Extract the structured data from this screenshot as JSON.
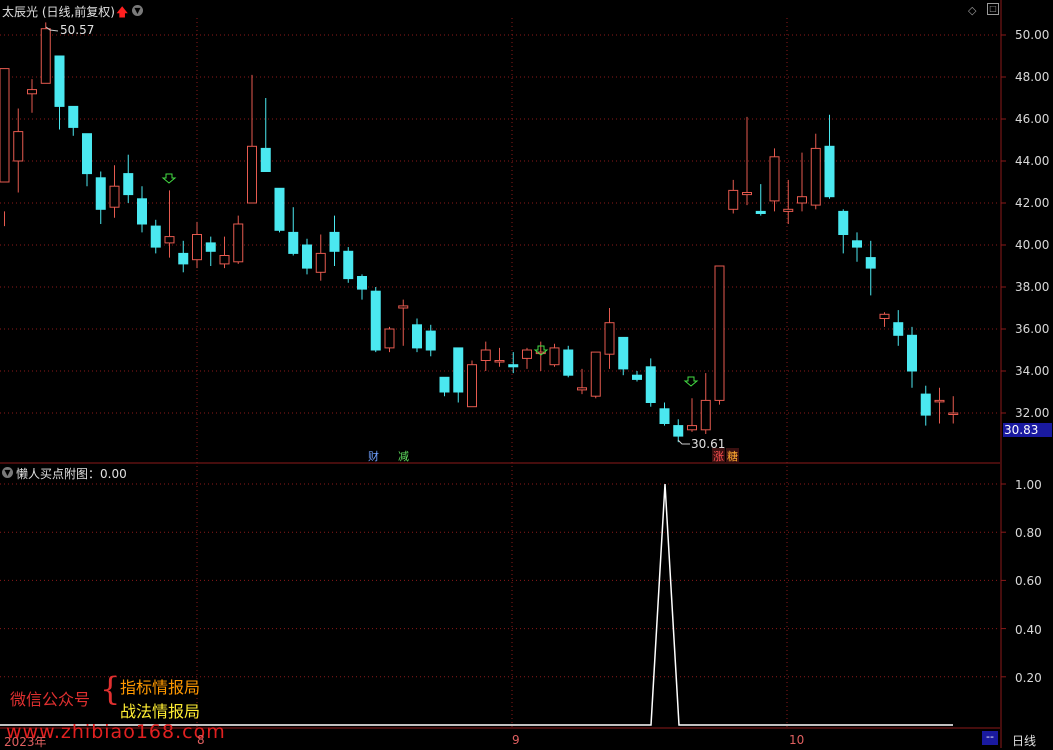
{
  "header": {
    "title": "太辰光 (日线,前复权)"
  },
  "indicator": {
    "title": "懒人买点附图：0.00"
  },
  "price_axis": {
    "labels": [
      "50.00",
      "48.00",
      "46.00",
      "44.00",
      "42.00",
      "40.00",
      "38.00",
      "36.00",
      "34.00",
      "32.00"
    ],
    "last_price": "30.83"
  },
  "ind_axis": {
    "labels": [
      "1.00",
      "0.80",
      "0.60",
      "0.40",
      "0.20"
    ]
  },
  "x_axis": {
    "labels": [
      "2023年",
      "8",
      "9",
      "10"
    ],
    "period": "日线",
    "period_btn": "--"
  },
  "annotations": {
    "high": "50.57",
    "low": "30.61"
  },
  "events": [
    {
      "label": "财",
      "color": "#6fa0ff"
    },
    {
      "label": "减",
      "color": "#60e060"
    },
    {
      "label": "涨",
      "color": "#ff5050"
    },
    {
      "label": "糖",
      "color": "#ffaa30"
    }
  ],
  "watermark": {
    "left": "微信公众号",
    "right1": "指标情报局",
    "right2": "战法情报局",
    "site": "www.zhibiao168.com"
  },
  "colors": {
    "up": "#e65a4f",
    "down": "#4be8f0",
    "grid": "#8b1a1a"
  },
  "chart_data": {
    "type": "candlestick",
    "ylim": [
      30,
      51
    ],
    "candles": [
      [
        43,
        48.4,
        40.9,
        41.6
      ],
      [
        44,
        45.4,
        42.5,
        46.5
      ],
      [
        47.2,
        47.4,
        46.3,
        47.9
      ],
      [
        47.7,
        50.3,
        47.7,
        50.6
      ],
      [
        49.0,
        46.6,
        45.5,
        49.0
      ],
      [
        46.6,
        45.6,
        45.2,
        46.6
      ],
      [
        45.3,
        43.4,
        42.8,
        45.3
      ],
      [
        43.2,
        41.7,
        41.0,
        43.5
      ],
      [
        41.8,
        42.8,
        41.3,
        43.8
      ],
      [
        43.4,
        42.4,
        42.0,
        44.3
      ],
      [
        42.2,
        41.0,
        40.6,
        42.8
      ],
      [
        40.9,
        39.9,
        39.6,
        41.2
      ],
      [
        40.1,
        40.4,
        39.4,
        42.6
      ],
      [
        39.6,
        39.1,
        38.7,
        40.2
      ],
      [
        39.3,
        40.5,
        38.9,
        41.1
      ],
      [
        40.1,
        39.7,
        39.0,
        40.4
      ],
      [
        39.1,
        39.5,
        38.9,
        40.4
      ],
      [
        39.2,
        41.0,
        39.1,
        41.4
      ],
      [
        42.0,
        44.7,
        42.0,
        48.1
      ],
      [
        44.6,
        43.5,
        43.5,
        47.0
      ],
      [
        42.7,
        40.7,
        40.6,
        42.7
      ],
      [
        40.6,
        39.6,
        39.5,
        41.8
      ],
      [
        40.0,
        38.9,
        38.6,
        40.3
      ],
      [
        38.7,
        39.6,
        38.3,
        40.5
      ],
      [
        40.6,
        39.7,
        39.0,
        41.4
      ],
      [
        39.7,
        38.4,
        38.2,
        39.9
      ],
      [
        38.5,
        37.9,
        37.4,
        38.6
      ],
      [
        37.8,
        35.0,
        34.9,
        38.0
      ],
      [
        35.1,
        36.0,
        34.9,
        36.1
      ],
      [
        37.0,
        37.1,
        35.2,
        37.4
      ],
      [
        36.2,
        35.1,
        34.9,
        36.5
      ],
      [
        35.9,
        35.0,
        34.7,
        36.2
      ],
      [
        33.7,
        33.0,
        32.8,
        33.7
      ],
      [
        35.1,
        33.0,
        32.5,
        35.1
      ],
      [
        32.3,
        34.3,
        32.3,
        34.5
      ],
      [
        34.5,
        35.0,
        34.0,
        35.4
      ],
      [
        34.5,
        34.5,
        34.2,
        35.1
      ],
      [
        34.3,
        34.2,
        33.9,
        34.9
      ],
      [
        34.6,
        35.0,
        34.1,
        35.1
      ],
      [
        34.9,
        34.9,
        34.0,
        35.4
      ],
      [
        34.3,
        35.1,
        34.2,
        35.3
      ],
      [
        35.0,
        33.8,
        33.7,
        35.2
      ],
      [
        33.1,
        33.2,
        32.9,
        34.1
      ],
      [
        32.8,
        34.9,
        32.7,
        34.9
      ],
      [
        34.8,
        36.3,
        34.1,
        37.0
      ],
      [
        35.6,
        34.1,
        33.8,
        35.6
      ],
      [
        33.8,
        33.6,
        33.5,
        34.0
      ],
      [
        34.2,
        32.5,
        32.3,
        34.6
      ],
      [
        32.2,
        31.5,
        31.4,
        32.5
      ],
      [
        31.4,
        30.9,
        30.61,
        31.7
      ],
      [
        31.2,
        31.4,
        31.1,
        32.7
      ],
      [
        31.2,
        32.6,
        31.0,
        33.9
      ],
      [
        32.6,
        39.0,
        32.4,
        39.0
      ],
      [
        41.7,
        42.6,
        41.5,
        43.1
      ],
      [
        42.4,
        42.5,
        41.9,
        46.1
      ],
      [
        41.6,
        41.5,
        41.4,
        42.9
      ],
      [
        42.1,
        44.2,
        41.6,
        44.6
      ],
      [
        41.6,
        41.7,
        41.0,
        43.1
      ],
      [
        42.0,
        42.3,
        41.6,
        44.4
      ],
      [
        41.9,
        44.6,
        41.7,
        45.3
      ],
      [
        44.7,
        42.3,
        42.2,
        46.2
      ],
      [
        41.6,
        40.5,
        39.6,
        41.7
      ],
      [
        40.2,
        39.9,
        39.2,
        40.6
      ],
      [
        39.4,
        38.9,
        37.6,
        40.2
      ],
      [
        36.5,
        36.7,
        36.1,
        36.8
      ],
      [
        36.3,
        35.7,
        35.2,
        36.9
      ],
      [
        35.7,
        34.0,
        33.2,
        36.1
      ],
      [
        32.9,
        31.9,
        31.4,
        33.3
      ],
      [
        32.6,
        32.6,
        31.5,
        33.2
      ],
      [
        32.0,
        32.0,
        31.5,
        32.8
      ]
    ],
    "indicator_values": {
      "baseline": 0,
      "peak": 1.0
    }
  }
}
